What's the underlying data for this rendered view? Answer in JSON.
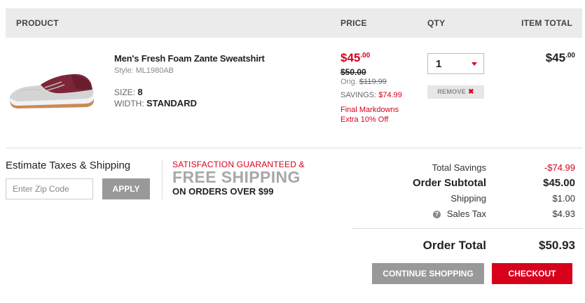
{
  "header": {
    "product": "PRODUCT",
    "price": "PRICE",
    "qty": "QTY",
    "item_total": "ITEM TOTAL"
  },
  "item": {
    "name": "Men's Fresh Foam Zante Sweatshirt",
    "style": "Style: ML1980AB",
    "size_label": "SIZE:",
    "size_value": "8",
    "width_label": "WIDTH:",
    "width_value": "STANDARD",
    "image_icon": "shoe-image",
    "price_dollars": "$45",
    "price_cents": ".00",
    "price_was": "$50.00",
    "orig_label": "Orig.",
    "orig_value": "$119.99",
    "savings_label": "SAVINGS:",
    "savings_value": "$74.99",
    "note_line1": "Final Markdowns",
    "note_line2": "Extra 10% Off",
    "qty_value": "1",
    "remove_label": "REMOVE",
    "remove_icon": "close-icon",
    "total_dollars": "$45",
    "total_cents": ".00"
  },
  "estimate": {
    "title": "Estimate Taxes & Shipping",
    "zip_placeholder": "Enter Zip Code",
    "apply_label": "APPLY"
  },
  "promo": {
    "line1": "SATISFACTION GUARANTEED &",
    "line2": "FREE SHIPPING",
    "line3": "ON ORDERS OVER $99"
  },
  "summary": {
    "savings_label": "Total Savings",
    "savings_value": "-$74.99",
    "subtotal_label": "Order Subtotal",
    "subtotal_value": "$45.00",
    "shipping_label": "Shipping",
    "shipping_value": "$1.00",
    "tax_label": "Sales Tax",
    "tax_value": "$4.93",
    "tax_help_icon": "question-icon",
    "total_label": "Order Total",
    "total_value": "$50.93"
  },
  "actions": {
    "continue_label": "CONTINUE SHOPPING",
    "checkout_label": "CHECKOUT"
  },
  "colors": {
    "accent": "#d9001c",
    "header_bg": "#ebebeb",
    "gray_button": "#999999"
  }
}
